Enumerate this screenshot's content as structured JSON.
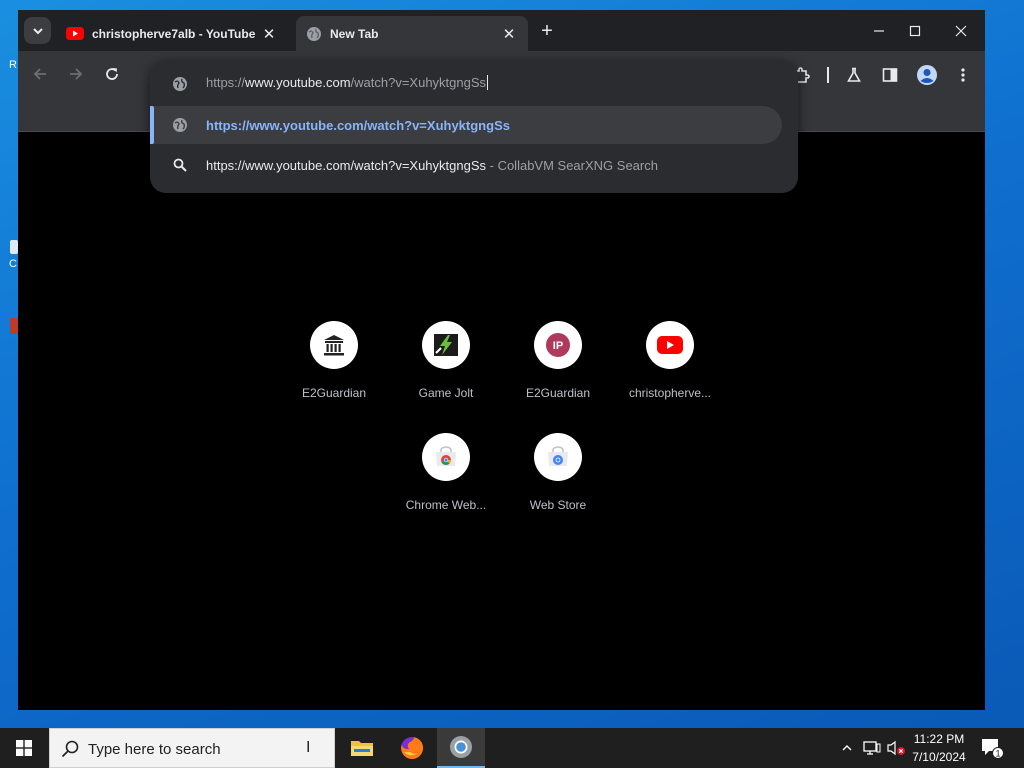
{
  "browser": {
    "tabs": [
      {
        "title": "christopherve7alb - YouTube",
        "icon": "youtube-icon",
        "active": false
      },
      {
        "title": "New Tab",
        "icon": "globe-icon",
        "active": true
      }
    ],
    "omnibox": {
      "input_scheme": "https://",
      "input_host": "www.youtube.com",
      "input_path": "/watch?v=XuhyktgngSs",
      "suggestions": [
        {
          "text": "https://www.youtube.com/watch?v=XuhyktgngSs",
          "suffix": "",
          "icon": "globe-icon",
          "selected": true
        },
        {
          "text": "https://www.youtube.com/watch?v=XuhyktgngSs",
          "suffix": " - CollabVM SearXNG Search",
          "icon": "search-icon",
          "selected": false
        }
      ]
    }
  },
  "shortcuts": [
    {
      "label": "E2Guardian",
      "icon": "e2guardian-icon"
    },
    {
      "label": "Game Jolt",
      "icon": "gamejolt-icon"
    },
    {
      "label": "E2Guardian",
      "icon": "ip-icon"
    },
    {
      "label": "christopherve...",
      "icon": "youtube-icon"
    },
    {
      "label": "Chrome Web...",
      "icon": "chrome-web-store-icon"
    },
    {
      "label": "Web Store",
      "icon": "chrome-web-store-icon"
    }
  ],
  "taskbar": {
    "search_placeholder": "Type here to search",
    "apps": [
      "file-explorer-icon",
      "firefox-icon",
      "chrome-icon"
    ],
    "time": "11:22 PM",
    "date": "7/10/2024",
    "notification_count": "1"
  },
  "desktop": {
    "fragments": [
      "R",
      "C"
    ]
  },
  "colors": {
    "accent": "#8ab4f8",
    "tab_active": "#35363a",
    "tabstrip": "#202124",
    "omnibox_bg": "#2b2c2f"
  }
}
